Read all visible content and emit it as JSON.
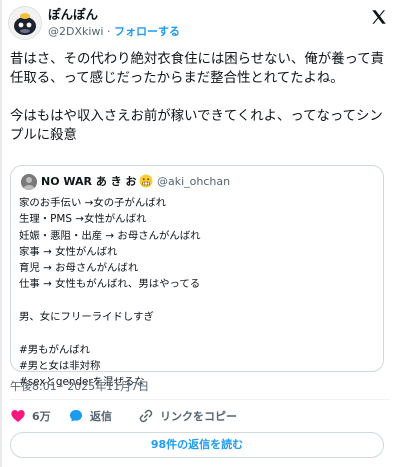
{
  "author": {
    "display_name": "ぽんぽん",
    "handle": "@2DXkiwi",
    "separator": "·",
    "follow_label": "フォローする"
  },
  "tweet": {
    "text": "昔はさ、その代わり絶対衣食住には困らせない、俺が養って責任取る、って感じだったからまだ整合性とれてたよね。\n\n今はもはや収入さえお前が稼いできてくれよ、ってなってシンプルに殺意",
    "timestamp": "午後8:01 · 2025年11月7日"
  },
  "quote": {
    "display_name": "NO WAR あ き お",
    "handle": "@aki_ohchan",
    "text": "家のお手伝い →女の子がんばれ\n生理・PMS →女性がんばれ\n妊娠・悪阻・出産 → お母さんがんばれ\n家事 → 女性がんばれ\n育児 → お母さんがんばれ\n仕事 → 女性もがんばれ、男はやってる\n\n男、女にフリーライドしすぎ\n\n#男もがんばれ\n#男と女は非対称\n#sexとgenderを混ぜるな"
  },
  "actions": {
    "like_count": "6万",
    "reply_label": "返信",
    "copy_link_label": "リンクをコピー"
  },
  "read_replies_label": "98件の返信を読む",
  "colors": {
    "accent": "#1d9bf0",
    "like": "#f91880",
    "muted": "#536471",
    "border": "#cfd9de"
  }
}
